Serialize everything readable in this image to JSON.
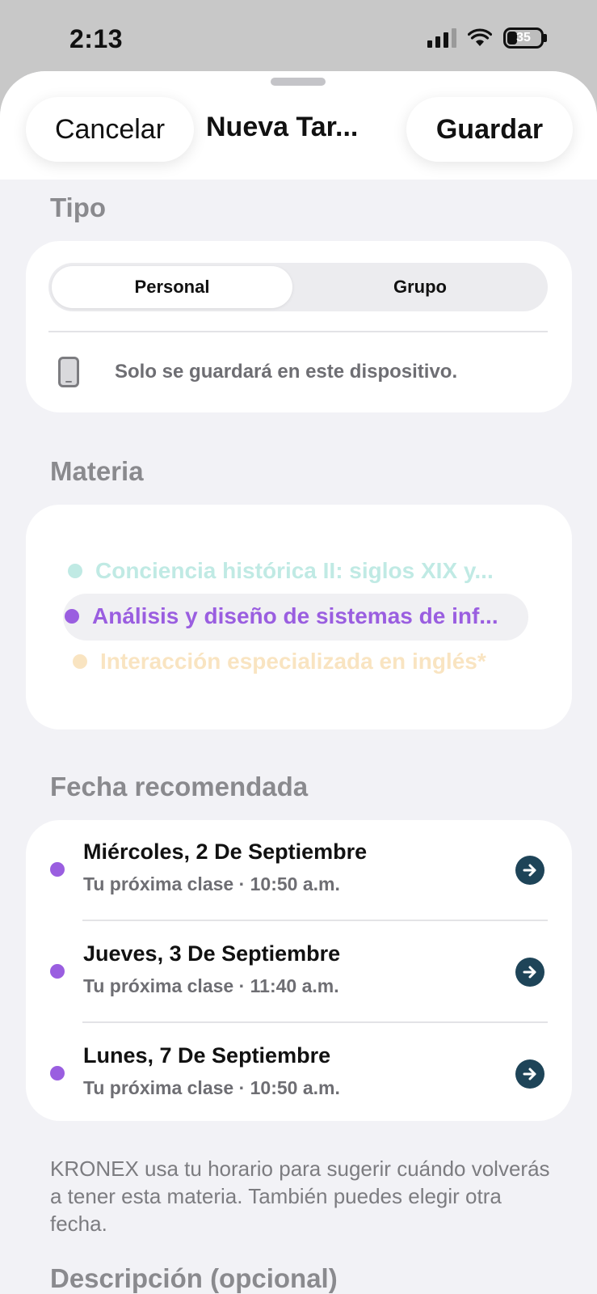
{
  "status_bar": {
    "time": "2:13",
    "battery_level": "35",
    "icons": [
      "signal-icon",
      "wifi-icon",
      "battery-icon"
    ]
  },
  "header": {
    "cancel_label": "Cancelar",
    "title": "Nueva Tar...",
    "save_label": "Guardar"
  },
  "tipo": {
    "section_title": "Tipo",
    "options": [
      "Personal",
      "Grupo"
    ],
    "selected": "Personal",
    "info_text": "Solo se guardará en este dispositivo."
  },
  "materia": {
    "section_title": "Materia",
    "items": [
      {
        "label": "Conciencia histórica II: siglos XIX y...",
        "color": "#8ed9cf",
        "selected": false
      },
      {
        "label": "Análisis y diseño de sistemas de inf...",
        "color": "#9a5ee0",
        "selected": true
      },
      {
        "label": "Interacción especializada en inglés*",
        "color": "#f7d9a8",
        "selected": false
      }
    ]
  },
  "fecha": {
    "section_title": "Fecha recomendada",
    "items": [
      {
        "title": "Miércoles, 2 De Septiembre",
        "subtitle": "Tu próxima clase · 10:50 a.m."
      },
      {
        "title": "Jueves, 3 De Septiembre",
        "subtitle": "Tu próxima clase · 11:40 a.m."
      },
      {
        "title": "Lunes, 7 De Septiembre",
        "subtitle": "Tu próxima clase · 10:50 a.m."
      }
    ],
    "dot_color": "#9a5ee0",
    "arrow_color": "#1e4458",
    "footnote": "KRONEX usa tu horario para sugerir cuándo volverás a tener esta materia. También puedes elegir otra fecha."
  },
  "descripcion": {
    "section_title": "Descripción (opcional)"
  }
}
